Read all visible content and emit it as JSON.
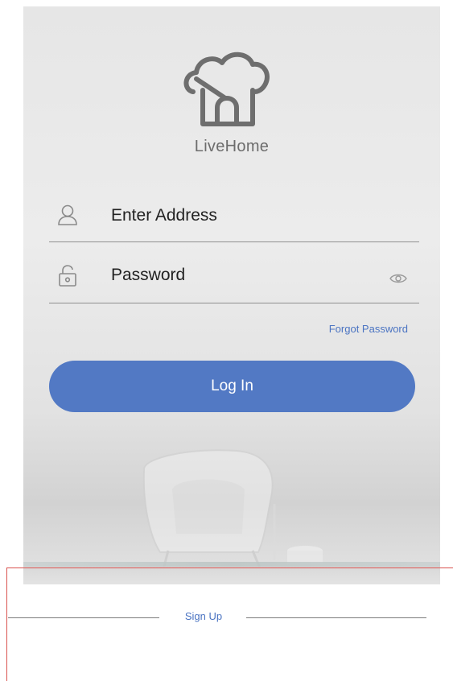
{
  "app": {
    "name": "LiveHome"
  },
  "login_form": {
    "address_placeholder": "Enter Address",
    "password_placeholder": "Password",
    "forgot_password": "Forgot Password",
    "login_label": "Log In"
  },
  "footer": {
    "signup_label": "Sign Up"
  },
  "icons": {
    "logo": "house-cloud-logo",
    "address": "user-icon",
    "password": "lock-icon",
    "visibility": "eye-icon"
  },
  "colors": {
    "accent": "#5279c4",
    "link": "#4b74c2",
    "annotation": "#d9534f",
    "text": "#222222"
  }
}
